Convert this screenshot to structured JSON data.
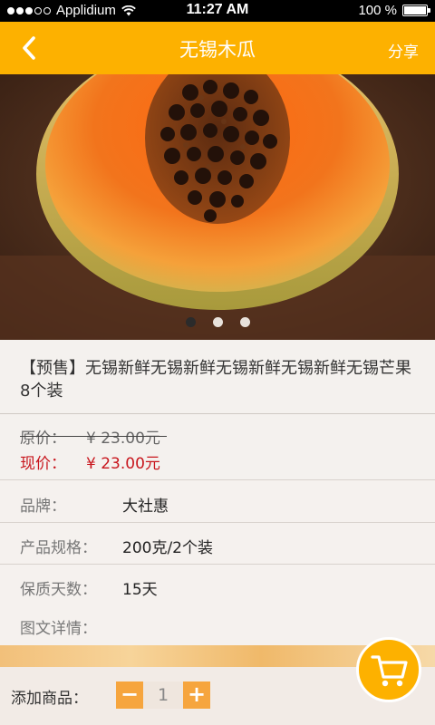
{
  "status_bar": {
    "carrier": "Applidium",
    "time": "11:27 AM",
    "battery": "100 %"
  },
  "nav": {
    "title": "无锡木瓜",
    "share_label": "分享"
  },
  "gallery": {
    "total_images": 3,
    "current_index": 0
  },
  "product": {
    "title": "【预售】无锡新鲜无锡新鲜无锡新鲜无锡新鲜无锡芒果8个装",
    "original_price_label": "原价：",
    "original_price": "¥ 23.00元",
    "current_price_label": "现价：",
    "current_price": "¥ 23.00元"
  },
  "info": [
    {
      "key": "品牌：",
      "value": "大社惠"
    },
    {
      "key": "产品规格：",
      "value": "200克/2个装"
    },
    {
      "key": "保质天数：",
      "value": "15天"
    },
    {
      "key": "图文详情：",
      "value": ""
    }
  ],
  "cart": {
    "add_label": "添加商品：",
    "minus": "−",
    "plus": "+",
    "quantity": "1"
  },
  "colors": {
    "accent": "#fdb100",
    "price_red": "#c8161d",
    "stepper_orange": "#f6a53e"
  }
}
